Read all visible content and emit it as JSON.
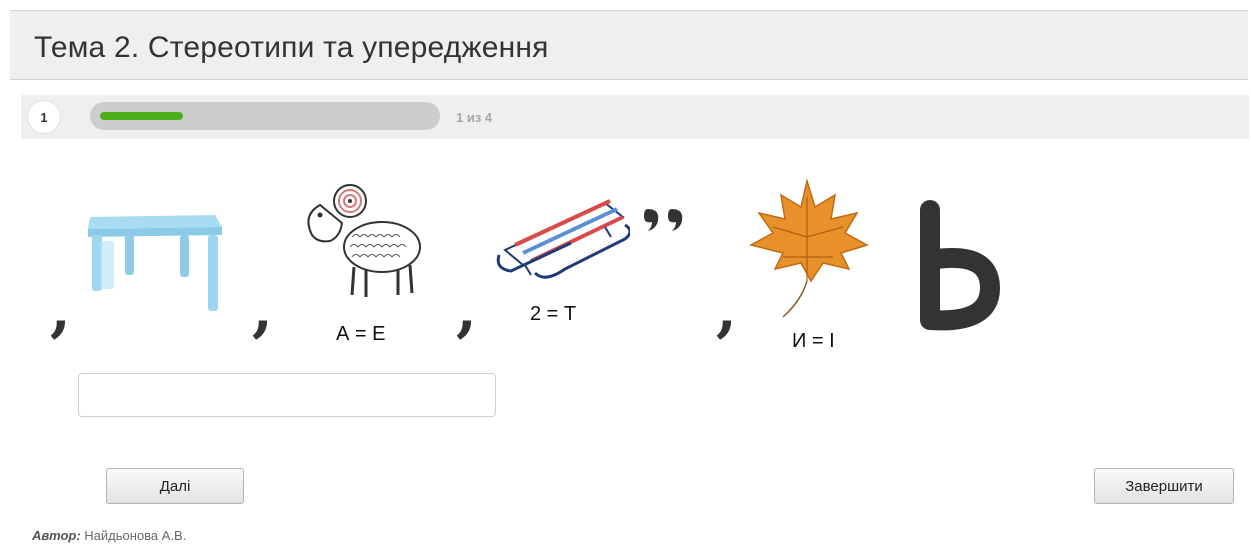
{
  "header": {
    "title": "Тема 2. Стереотипи та упередження"
  },
  "progress": {
    "question_number": "1",
    "counter": "1 из 4",
    "fraction": 0.25
  },
  "rebus": {
    "pictures": [
      "table-picture",
      "ram-picture",
      "sled-picture",
      "maple-leaf-picture"
    ],
    "commas": [
      ",",
      ",",
      ",",
      ","
    ],
    "sled_commas": "ﾞ",
    "hints": [
      "А = Е",
      "2 = Т",
      "И = І"
    ],
    "final_letter": "Ь"
  },
  "answer": {
    "value": "",
    "placeholder": ""
  },
  "buttons": {
    "next": "Далі",
    "finish": "Завершити"
  },
  "footer": {
    "author_label": "Автор:",
    "author_name": "Найдьонова А.В."
  },
  "colors": {
    "progress_fill": "#4caf1a",
    "track": "#cdcdcd",
    "header_bg": "#efefef"
  }
}
